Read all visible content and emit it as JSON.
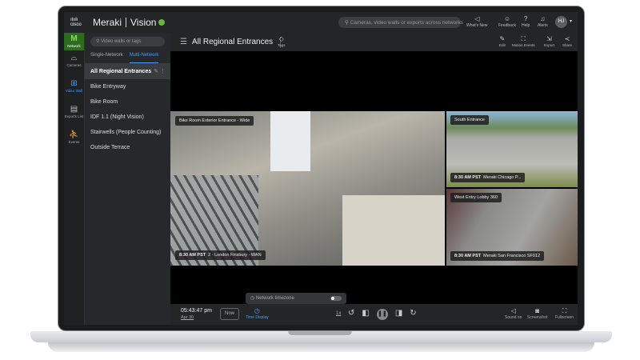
{
  "topbar": {
    "logo": "cisco",
    "brand": "Meraki",
    "product": "Vision",
    "search_placeholder": "Cameras, video walls or exports across networks",
    "actions": [
      {
        "label": "What's New",
        "icon": "megaphone-icon"
      },
      {
        "label": "Feedback",
        "icon": "feedback-icon"
      },
      {
        "label": "Help",
        "icon": "help-icon"
      },
      {
        "label": "Alerts",
        "icon": "bell-icon"
      }
    ],
    "avatar": "HJ"
  },
  "rail": [
    {
      "label": "Network",
      "glyph": "M"
    },
    {
      "label": "Cameras"
    },
    {
      "label": "Video Wall"
    },
    {
      "label": "Exports List"
    },
    {
      "label": "Events"
    }
  ],
  "sidebar": {
    "search_placeholder": "Video walls or tags",
    "tabs": [
      "Single-Network",
      "Multi-Network"
    ],
    "items": [
      "All Regional Entrances",
      "Bike Entryway",
      "Bike Room",
      "IDF 1.1 (Night Vision)",
      "Stairwells (People Counting)",
      "Outside Terrace"
    ]
  },
  "header": {
    "title": "All Regional Entrances",
    "tags": "Tags",
    "actions": [
      "Edit",
      "Motion Events",
      "Export",
      "Share"
    ]
  },
  "tiles": [
    {
      "name": "Bike Room Exterior Entrance - Wide",
      "time": "8:30 AM PST",
      "network": "2 - London Finsbury - WAN"
    },
    {
      "name": "South Entrance",
      "time": "8:30 AM PST",
      "network": "Meraki Chicago P..."
    },
    {
      "name": "West Entry Lobby 360",
      "time": "8:30 AM PST",
      "network": "Meraki San Francisco SF012"
    }
  ],
  "playback": {
    "time": "05:43:47 pm",
    "date": "Apr 30",
    "now": "Now",
    "time_display": "Time Display",
    "popup": "Network timezone",
    "popup_toggle": false,
    "speed": "1x",
    "right": [
      "Sound on",
      "Screenshot",
      "Fullscreen"
    ]
  },
  "colors": {
    "accent": "#3ca0ff",
    "network": "#2e6b1f",
    "vision": "#67b346"
  }
}
